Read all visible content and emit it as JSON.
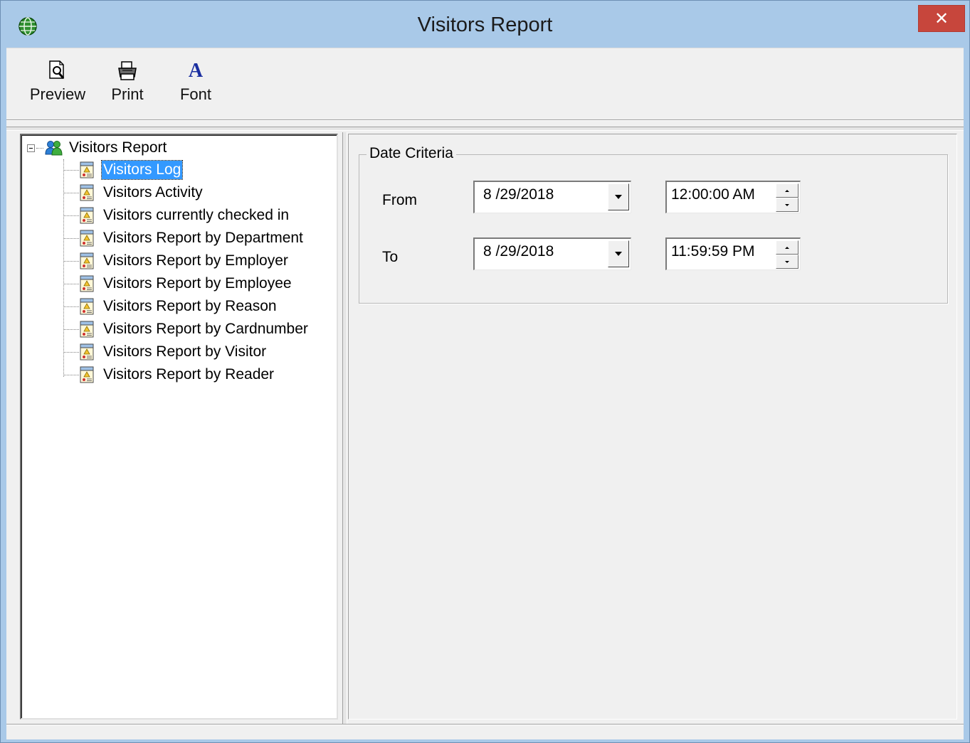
{
  "window": {
    "title": "Visitors Report",
    "close_glyph": "✕",
    "app_icon": "globe-icon"
  },
  "toolbar": {
    "items": [
      {
        "label": "Preview",
        "icon": "preview-icon"
      },
      {
        "label": "Print",
        "icon": "printer-icon"
      },
      {
        "label": "Font",
        "icon": "font-icon",
        "icon_glyph": "A"
      }
    ]
  },
  "tree": {
    "root": {
      "label": "Visitors Report",
      "icon": "people-icon",
      "expander_glyph": "minus"
    },
    "selected_index": 0,
    "items": [
      {
        "label": "Visitors Log"
      },
      {
        "label": "Visitors Activity"
      },
      {
        "label": "Visitors currently checked in"
      },
      {
        "label": "Visitors Report by Department"
      },
      {
        "label": "Visitors Report by Employer"
      },
      {
        "label": "Visitors Report by Employee"
      },
      {
        "label": "Visitors Report by Reason"
      },
      {
        "label": "Visitors Report by Cardnumber"
      },
      {
        "label": "Visitors Report by Visitor"
      },
      {
        "label": "Visitors Report by Reader"
      }
    ]
  },
  "date_criteria": {
    "title": "Date Criteria",
    "from": {
      "label": "From",
      "date": "8 /29/2018",
      "time": "12:00:00 AM"
    },
    "to": {
      "label": "To",
      "date": "8 /29/2018",
      "time": "11:59:59 PM"
    }
  },
  "colors": {
    "title_bar": "#a9c9e8",
    "close_button": "#c7463c",
    "selection": "#3399ff",
    "client_bg": "#f0f0f0"
  }
}
